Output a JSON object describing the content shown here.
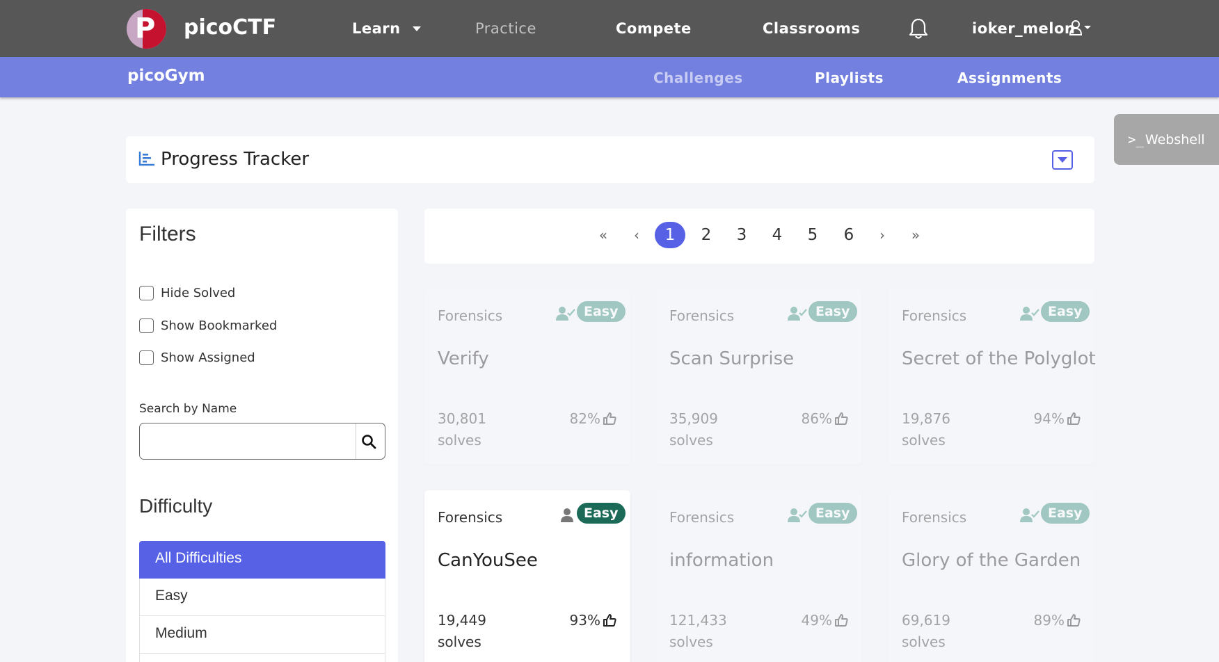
{
  "navbar": {
    "brand": "picoCTF",
    "logo_letter": "P",
    "links": [
      "Learn",
      "Practice",
      "Compete",
      "Classrooms"
    ],
    "username": "ioker_melon"
  },
  "subnav": {
    "brand": "picoGym",
    "links": [
      "Challenges",
      "Playlists",
      "Assignments"
    ]
  },
  "webshell": {
    "prompt": ">_",
    "label": "Webshell"
  },
  "tracker": {
    "title": "Progress Tracker"
  },
  "filters": {
    "title": "Filters",
    "checkboxes": [
      "Hide Solved",
      "Show Bookmarked",
      "Show Assigned"
    ],
    "search_label": "Search by Name",
    "search_value": "",
    "difficulty_title": "Difficulty",
    "difficulties": [
      "All Difficulties",
      "Easy",
      "Medium"
    ]
  },
  "pagination": {
    "first": "«",
    "prev": "‹",
    "pages": [
      "1",
      "2",
      "3",
      "4",
      "5",
      "6"
    ],
    "current": "1",
    "next": "›",
    "last": "»"
  },
  "cards": [
    {
      "category": "Forensics",
      "difficulty": "Easy",
      "name": "Verify",
      "solves": "30,801",
      "solves_label": "solves",
      "likes": "82%",
      "solved": true
    },
    {
      "category": "Forensics",
      "difficulty": "Easy",
      "name": "Scan Surprise",
      "solves": "35,909",
      "solves_label": "solves",
      "likes": "86%",
      "solved": true
    },
    {
      "category": "Forensics",
      "difficulty": "Easy",
      "name": "Secret of the Polyglot",
      "solves": "19,876",
      "solves_label": "solves",
      "likes": "94%",
      "solved": true
    },
    {
      "category": "Forensics",
      "difficulty": "Easy",
      "name": "CanYouSee",
      "solves": "19,449",
      "solves_label": "solves",
      "likes": "93%",
      "solved": false
    },
    {
      "category": "Forensics",
      "difficulty": "Easy",
      "name": "information",
      "solves": "121,433",
      "solves_label": "solves",
      "likes": "49%",
      "solved": true
    },
    {
      "category": "Forensics",
      "difficulty": "Easy",
      "name": "Glory of the Garden",
      "solves": "69,619",
      "solves_label": "solves",
      "likes": "89%",
      "solved": true
    }
  ],
  "colors": {
    "accent": "#5661e6",
    "navbar": "#575757",
    "subnav": "#7380df",
    "badge": "#2e8a75"
  }
}
